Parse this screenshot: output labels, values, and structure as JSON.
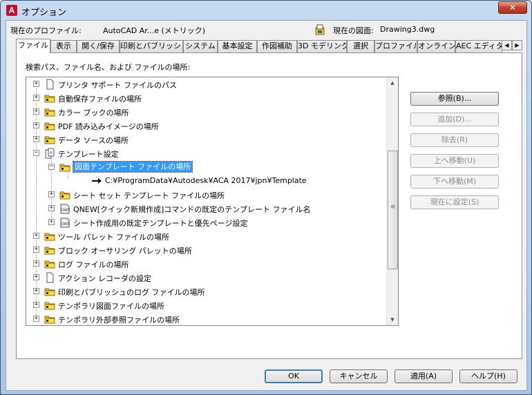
{
  "window": {
    "title": "オプション",
    "close_label": "✕"
  },
  "profile": {
    "current_profile_label": "現在のプロファイル:",
    "current_profile_value": "AutoCAD Ar...e (メトリック)",
    "current_drawing_label": "現在の図面:",
    "current_drawing_value": "Drawing3.dwg"
  },
  "tabs": [
    {
      "label": "ファイル"
    },
    {
      "label": "表示"
    },
    {
      "label": "開く/保存"
    },
    {
      "label": "印刷とパブリッシュ"
    },
    {
      "label": "システム"
    },
    {
      "label": "基本設定"
    },
    {
      "label": "作図補助"
    },
    {
      "label": "3D モデリング"
    },
    {
      "label": "選択"
    },
    {
      "label": "プロファイル"
    },
    {
      "label": "オンライン"
    },
    {
      "label": "AEC エディタ"
    }
  ],
  "files_tab": {
    "tree_label": "検索パス、ファイル名、および ファイルの場所:",
    "tree": [
      {
        "label": "プリンタ サポート ファイルのパス"
      },
      {
        "label": "自動保存ファイルの場所"
      },
      {
        "label": "カラー ブックの場所"
      },
      {
        "label": "PDF 読み込みイメージの場所"
      },
      {
        "label": "データ ソースの場所"
      },
      {
        "label": "テンプレート設定"
      },
      {
        "label": "図面テンプレート ファイルの場所"
      },
      {
        "label": "C:¥ProgramData¥Autodesk¥ACA 2017¥jpn¥Template"
      },
      {
        "label": "シート セット テンプレート ファイルの場所"
      },
      {
        "label": "QNEW[クイック新規作成]コマンドの既定のテンプレート ファイル名"
      },
      {
        "label": "シート作成用の既定テンプレートと優先ページ設定"
      },
      {
        "label": "ツール パレット ファイルの場所"
      },
      {
        "label": "ブロック オーサリング パレットの場所"
      },
      {
        "label": "ログ ファイルの場所"
      },
      {
        "label": "アクション レコーダの設定"
      },
      {
        "label": "印刷とパブリッシュのログ ファイルの場所"
      },
      {
        "label": "テンポラリ図面ファイルの場所"
      },
      {
        "label": "テンポラリ外部参照ファイルの場所"
      }
    ],
    "buttons": {
      "browse": "参照(B)...",
      "add": "追加(D)...",
      "remove": "除去(R)",
      "move_up": "上へ移動(U)",
      "move_down": "下へ移動(M)",
      "set_current": "現在に設定(S)"
    }
  },
  "footer": {
    "ok": "OK",
    "cancel": "キャンセル",
    "apply": "適用(A)",
    "help": "ヘルプ(H)"
  },
  "colors": {
    "selection": "#3399ff",
    "folder": "#f5c518",
    "title_bar": "#b8d0ec"
  }
}
